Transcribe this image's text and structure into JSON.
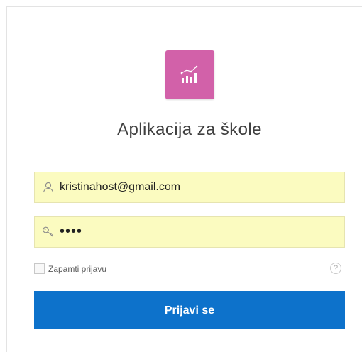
{
  "app": {
    "title": "Aplikacija za škole",
    "logo_icon": "bar-chart-icon",
    "logo_color": "#d261a9"
  },
  "login": {
    "email_icon": "user-icon",
    "email_value": "kristinahost@gmail.com",
    "password_icon": "key-icon",
    "password_value": "••••",
    "remember_label": "Zapamti prijavu",
    "remember_checked": false,
    "help_icon": "help-icon",
    "help_symbol": "?",
    "submit_label": "Prijavi se",
    "submit_color": "#0d72cb",
    "field_background": "#fbfbc0"
  }
}
